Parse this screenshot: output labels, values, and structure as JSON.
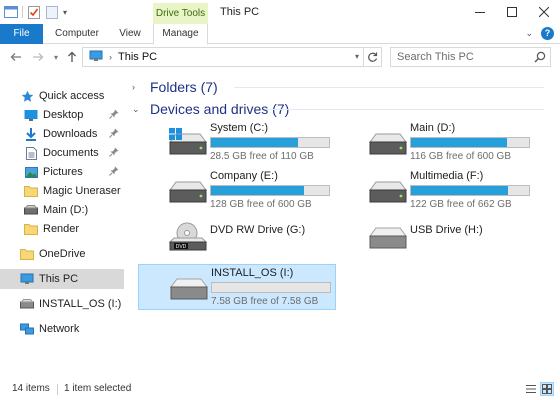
{
  "window": {
    "title": "This PC",
    "context_tab": "Drive Tools"
  },
  "ribbon": {
    "tabs": [
      "File",
      "Computer",
      "View",
      "Manage"
    ]
  },
  "address": {
    "crumb": "This PC"
  },
  "search": {
    "placeholder": "Search This PC"
  },
  "navpane": {
    "items": [
      {
        "label": "Quick access",
        "icon": "star-icon"
      },
      {
        "label": "Desktop",
        "icon": "desktop-folder-icon",
        "pinned": true
      },
      {
        "label": "Downloads",
        "icon": "downloads-folder-icon",
        "pinned": true
      },
      {
        "label": "Documents",
        "icon": "documents-folder-icon",
        "pinned": true
      },
      {
        "label": "Pictures",
        "icon": "pictures-folder-icon",
        "pinned": true
      },
      {
        "label": "Magic Uneraser",
        "icon": "folder-icon"
      },
      {
        "label": "Main (D:)",
        "icon": "drive-icon"
      },
      {
        "label": "Render",
        "icon": "folder-icon"
      },
      {
        "label": "OneDrive",
        "icon": "onedrive-folder-icon"
      },
      {
        "label": "This PC",
        "icon": "computer-icon",
        "selected": true
      },
      {
        "label": "INSTALL_OS (I:)",
        "icon": "usb-drive-icon"
      },
      {
        "label": "Network",
        "icon": "network-icon"
      }
    ]
  },
  "groups": {
    "folders": "Folders (7)",
    "devices": "Devices and drives (7)"
  },
  "drives": [
    {
      "name": "System (C:)",
      "free": "28.5 GB free of 110 GB",
      "used_fraction": 0.74,
      "has_bar": true,
      "icon": "system-drive-icon"
    },
    {
      "name": "Main (D:)",
      "free": "116 GB free of 600 GB",
      "used_fraction": 0.81,
      "has_bar": true,
      "icon": "hard-drive-icon"
    },
    {
      "name": "Company (E:)",
      "free": "128 GB free of 600 GB",
      "used_fraction": 0.79,
      "has_bar": true,
      "icon": "hard-drive-icon"
    },
    {
      "name": "Multimedia (F:)",
      "free": "122 GB free of 662 GB",
      "used_fraction": 0.82,
      "has_bar": true,
      "icon": "hard-drive-icon"
    },
    {
      "name": "DVD RW Drive (G:)",
      "free": "",
      "used_fraction": 0,
      "has_bar": false,
      "icon": "dvd-drive-icon"
    },
    {
      "name": "USB Drive (H:)",
      "free": "",
      "used_fraction": 0,
      "has_bar": false,
      "icon": "usb-drive-icon"
    },
    {
      "name": "INSTALL_OS (I:)",
      "free": "7.58 GB free of 7.58 GB",
      "used_fraction": 0,
      "has_bar": true,
      "icon": "usb-drive-icon",
      "selected": true
    }
  ],
  "status": {
    "items": "14 items",
    "selected": "1 item selected"
  },
  "colors": {
    "accent": "#1979ca",
    "bar_fill": "#26a0da",
    "selection": "#cce8ff",
    "group_header": "#1e3287",
    "context_tab": "#e9f5c7"
  }
}
